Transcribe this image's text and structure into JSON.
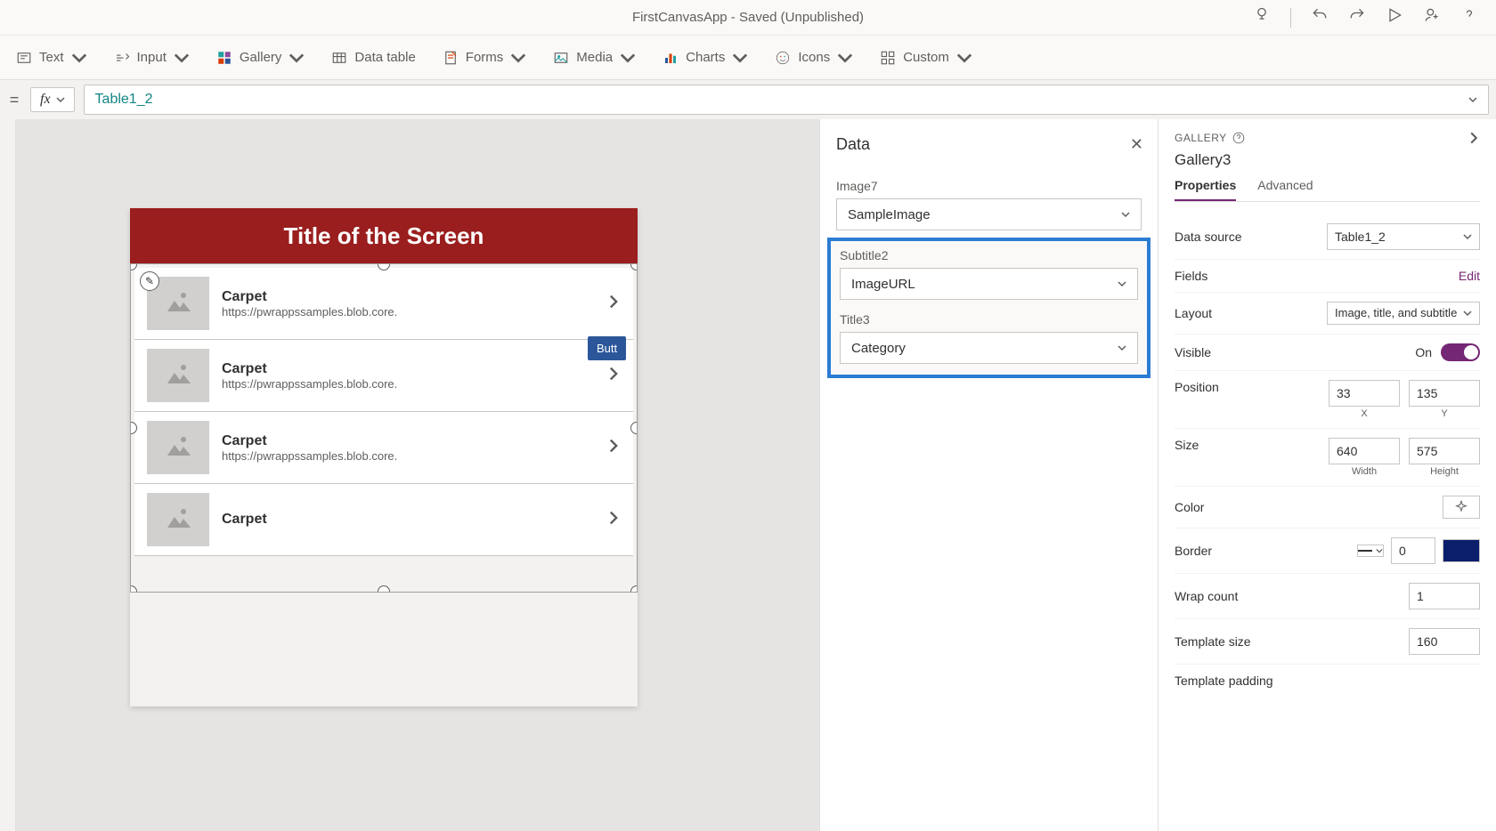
{
  "titlebar": {
    "app_title": "FirstCanvasApp - Saved (Unpublished)"
  },
  "ribbon": {
    "text": "Text",
    "input": "Input",
    "gallery": "Gallery",
    "data_table": "Data table",
    "forms": "Forms",
    "media": "Media",
    "charts": "Charts",
    "icons": "Icons",
    "custom": "Custom"
  },
  "formula": {
    "value": "Table1_2"
  },
  "canvas": {
    "screen_title": "Title of the Screen",
    "button_label": "Butt",
    "gallery_items": [
      {
        "title": "Carpet",
        "subtitle": "https://pwrappssamples.blob.core."
      },
      {
        "title": "Carpet",
        "subtitle": "https://pwrappssamples.blob.core."
      },
      {
        "title": "Carpet",
        "subtitle": "https://pwrappssamples.blob.core."
      },
      {
        "title": "Carpet",
        "subtitle": ""
      }
    ]
  },
  "data_panel": {
    "title": "Data",
    "fields": {
      "image": {
        "label": "Image7",
        "value": "SampleImage"
      },
      "subtitle": {
        "label": "Subtitle2",
        "value": "ImageURL"
      },
      "title": {
        "label": "Title3",
        "value": "Category"
      }
    }
  },
  "props": {
    "category": "GALLERY",
    "name": "Gallery3",
    "tabs": {
      "properties": "Properties",
      "advanced": "Advanced"
    },
    "data_source": {
      "label": "Data source",
      "value": "Table1_2"
    },
    "fields": {
      "label": "Fields",
      "action": "Edit"
    },
    "layout": {
      "label": "Layout",
      "value": "Image, title, and subtitle"
    },
    "visible": {
      "label": "Visible",
      "value": "On"
    },
    "position": {
      "label": "Position",
      "x": "33",
      "y": "135",
      "xlabel": "X",
      "ylabel": "Y"
    },
    "size": {
      "label": "Size",
      "w": "640",
      "h": "575",
      "wlabel": "Width",
      "hlabel": "Height"
    },
    "color": {
      "label": "Color"
    },
    "border": {
      "label": "Border",
      "value": "0"
    },
    "wrap_count": {
      "label": "Wrap count",
      "value": "1"
    },
    "template_size": {
      "label": "Template size",
      "value": "160"
    },
    "template_padding": {
      "label": "Template padding"
    }
  }
}
